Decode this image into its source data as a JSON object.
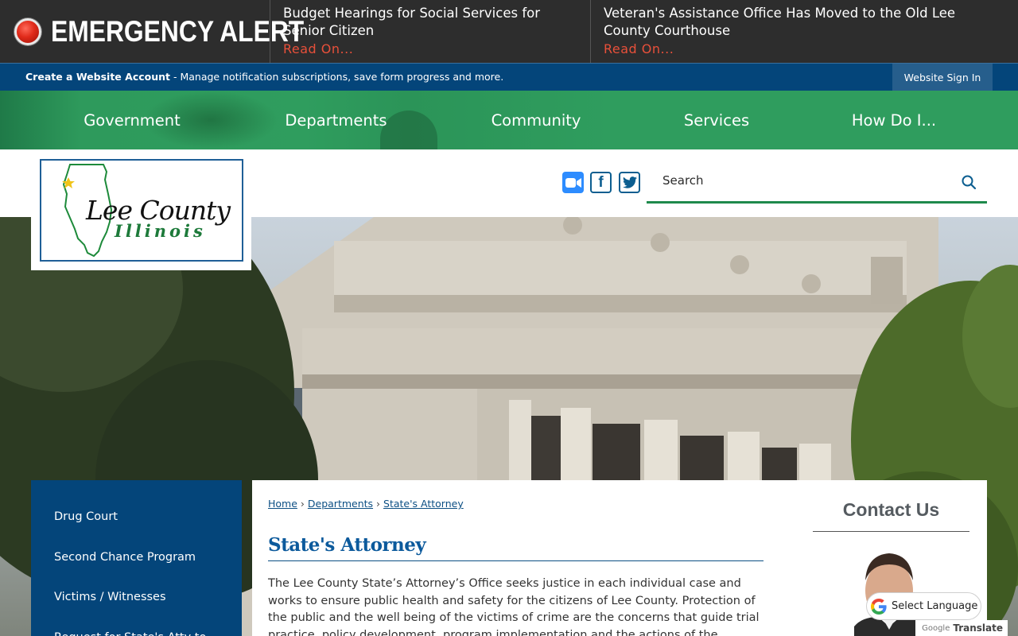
{
  "alert": {
    "title": "EMERGENCY ALERT",
    "items": [
      {
        "title": "Budget Hearings for Social Services for Senior Citizen",
        "link": "Read On..."
      },
      {
        "title": "Veteran's Assistance Office Has Moved to the Old Lee County Courthouse",
        "link": "Read On..."
      }
    ]
  },
  "account": {
    "create_label": "Create a Website Account",
    "description": " - Manage notification subscriptions, save form progress and more.",
    "signin_label": "Website Sign In"
  },
  "nav": {
    "items": [
      "Government",
      "Departments",
      "Community",
      "Services",
      "How Do I..."
    ]
  },
  "logo": {
    "line1": "Lee County",
    "line2": "Illinois"
  },
  "social": [
    "zoom-icon",
    "facebook-icon",
    "twitter-icon"
  ],
  "search": {
    "placeholder": "Search"
  },
  "sidebar": {
    "items": [
      "Drug Court",
      "Second Chance Program",
      "Victims / Witnesses",
      "Request for State's Atty to"
    ]
  },
  "breadcrumb": {
    "items": [
      "Home",
      "Departments",
      "State's Attorney"
    ],
    "separator": "›"
  },
  "page": {
    "title": "State's Attorney",
    "body": "The Lee County State’s Attorney’s Office seeks justice in each individual case and works to ensure public health and safety for the citizens of Lee County. Protection of the public and the well being of the victims of crime are the concerns that guide trial practice, policy development, program implementation and the actions of the professionals"
  },
  "contact": {
    "title": "Contact Us"
  },
  "translate": {
    "label": "Select Language",
    "powered_google": "Google",
    "powered_translate": "Translate"
  },
  "colors": {
    "alert_bg": "#2d2d2d",
    "alert_link": "#e8503a",
    "account_bar": "#04457a",
    "nav_green": "#2f9d5e",
    "sidebar_blue": "#04457a",
    "title_blue": "#0c5a9c"
  }
}
